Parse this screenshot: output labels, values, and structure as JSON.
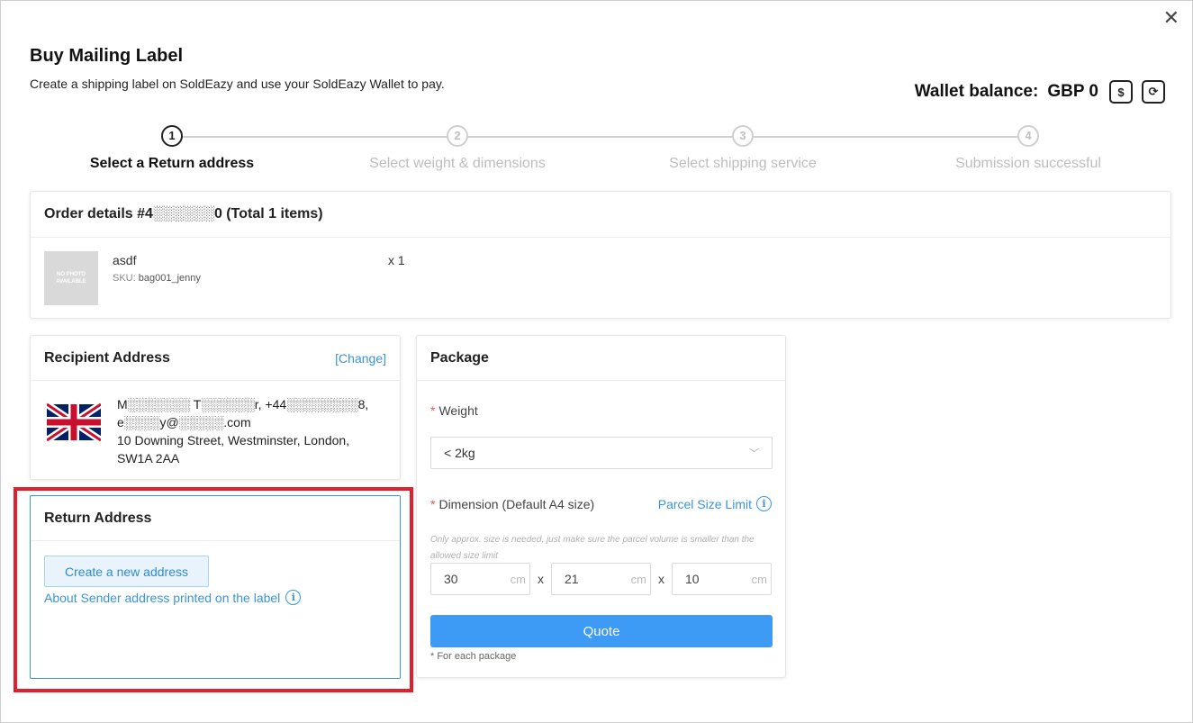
{
  "modal": {
    "close_glyph": "✕",
    "title": "Buy Mailing Label",
    "subtitle": "Create a shipping label on SoldEazy and use your SoldEazy Wallet to pay."
  },
  "wallet": {
    "label": "Wallet balance:",
    "value": "GBP 0",
    "topup_icon": "$",
    "refresh_icon": "⟳"
  },
  "steps": [
    {
      "num": "1",
      "label": "Select a Return address",
      "active": true
    },
    {
      "num": "2",
      "label": "Select weight & dimensions",
      "active": false
    },
    {
      "num": "3",
      "label": "Select shipping service",
      "active": false
    },
    {
      "num": "4",
      "label": "Submission successful",
      "active": false
    }
  ],
  "order": {
    "title": "Order details #4░░░░░░0 (Total 1 items)",
    "photo_text": "NO PHOTO AVAILABLE",
    "item_name": "asdf",
    "sku_label": "SKU:",
    "sku_value": "bag001_jenny",
    "qty": "x 1"
  },
  "recipient": {
    "title": "Recipient Address",
    "change_link": "[Change]",
    "line1": "M░░░░░░░ T░░░░░░r, +44░░░░░░░░8,",
    "line2": "e░░░░y@░░░░░.com",
    "line3": "10 Downing Street, Westminster, London,",
    "line4": "SW1A 2AA"
  },
  "return_address": {
    "title": "Return Address",
    "create_button": "Create a new address",
    "about_link": "About Sender address printed on the label",
    "info_glyph": "i"
  },
  "package": {
    "title": "Package",
    "weight_label": "Weight",
    "required_mark": "*",
    "weight_value": "< 2kg",
    "chevron": "﹀",
    "dimension_label": "Dimension (Default A4 size)",
    "parcel_link": "Parcel Size Limit",
    "hint": "Only approx. size is needed, just make sure the parcel volume is smaller than the allowed size limit",
    "length": "30",
    "width": "21",
    "height": "10",
    "unit": "cm",
    "times": "x",
    "quote_button": "Quote",
    "note": "* For each package"
  },
  "colors": {
    "accent": "#3a94db",
    "primary_button": "#3e9bf5",
    "highlight": "#e0202a"
  }
}
